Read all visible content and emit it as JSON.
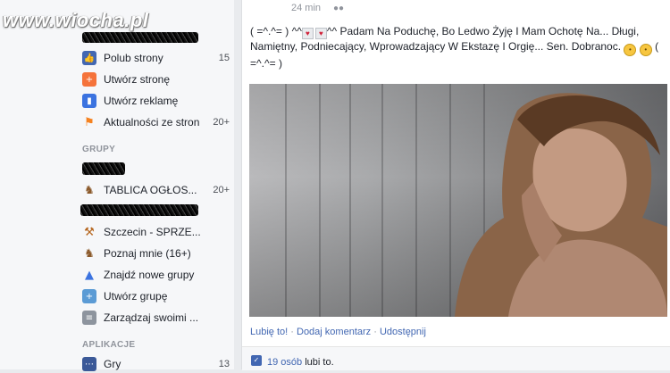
{
  "watermark": "www.wiocha.pl",
  "sidebar": {
    "pages_items": [
      {
        "label": "Polub strony",
        "count": "15",
        "icon": "thumbs-up-icon",
        "color": "#4267b2"
      },
      {
        "label": "Utwórz stronę",
        "count": "",
        "icon": "create-page-icon",
        "color": "#f5733b"
      },
      {
        "label": "Utwórz reklamę",
        "count": "",
        "icon": "chart-icon",
        "color": "#3b73e0"
      },
      {
        "label": "Aktualności ze stron",
        "count": "20+",
        "icon": "megaphone-icon",
        "color": "#f58220"
      }
    ],
    "groups_header": "GRUPY",
    "groups_items": [
      {
        "label": "TABLICA OGŁOS...",
        "count": "20+",
        "icon": "horse-icon",
        "color": "#8b5a2b"
      },
      {
        "label": "Szczecin - SPRZE...",
        "count": "",
        "icon": "gavel-icon",
        "color": "#b5651d"
      },
      {
        "label": "Poznaj mnie (16+)",
        "count": "",
        "icon": "horse-icon",
        "color": "#8b5a2b"
      },
      {
        "label": "Znajdź nowe grupy",
        "count": "",
        "icon": "rocket-icon",
        "color": "#3b73e0"
      },
      {
        "label": "Utwórz grupę",
        "count": "",
        "icon": "plus-icon",
        "color": "#5b9bd5"
      },
      {
        "label": "Zarządzaj swoimi ...",
        "count": "",
        "icon": "list-icon",
        "color": "#8d949e"
      }
    ],
    "apps_header": "APLIKACJE",
    "apps_items": [
      {
        "label": "Gry",
        "count": "13",
        "icon": "dice-icon",
        "color": "#3b5998"
      }
    ]
  },
  "post": {
    "time": "24 min",
    "audience_icon": "friends-icon",
    "text_a": "( =^.^= ) ^^",
    "text_b": "^^ Padam Na Poduchę, Bo Ledwo Żyję I Mam Ochotę Na... Długi, Namiętny, Podniecający, Wprowadzający W Ekstazę I Orgię... Sen. Dobranoc.",
    "text_c": "( =^.^= )",
    "actions": {
      "like": "Lubię to!",
      "comment": "Dodaj komentarz",
      "share": "Udostępnij",
      "separator": "·"
    },
    "likes": {
      "count_text": "19 osób",
      "suffix": "lubi to."
    }
  }
}
